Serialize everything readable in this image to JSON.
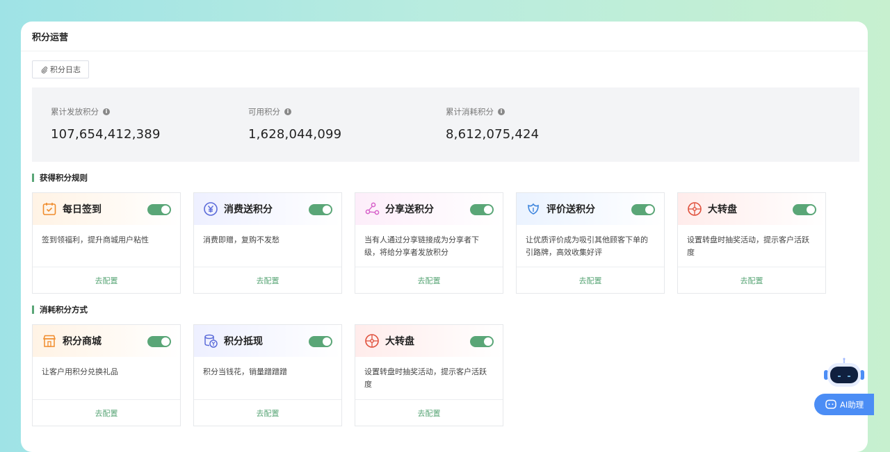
{
  "page": {
    "title": "积分运营"
  },
  "toolbar": {
    "log_label": "积分日志"
  },
  "stats": [
    {
      "label": "累计发放积分",
      "value": "107,654,412,389"
    },
    {
      "label": "可用积分",
      "value": "1,628,044,099"
    },
    {
      "label": "累计消耗积分",
      "value": "8,612,075,424"
    }
  ],
  "earn_section": {
    "title": "获得积分规则",
    "cards": [
      {
        "title": "每日签到",
        "desc": "签到领福利，提升商城用户粘性",
        "action": "去配置",
        "icon": "calendar-check-icon",
        "enabled": true
      },
      {
        "title": "消费送积分",
        "desc": "消费即赠，复购不发愁",
        "action": "去配置",
        "icon": "yen-circle-icon",
        "enabled": true
      },
      {
        "title": "分享送积分",
        "desc": "当有人通过分享链接成为分享者下级，将给分享者发放积分",
        "action": "去配置",
        "icon": "share-icon",
        "enabled": true
      },
      {
        "title": "评价送积分",
        "desc": "让优质评价成为吸引其他顾客下单的引路牌，高效收集好评",
        "action": "去配置",
        "icon": "review-flower-icon",
        "enabled": true
      },
      {
        "title": "大转盘",
        "desc": "设置转盘时抽奖活动，提示客户活跃度",
        "action": "去配置",
        "icon": "wheel-icon",
        "enabled": true
      }
    ]
  },
  "spend_section": {
    "title": "消耗积分方式",
    "cards": [
      {
        "title": "积分商城",
        "desc": "让客户用积分兑换礼品",
        "action": "去配置",
        "icon": "store-icon",
        "enabled": true
      },
      {
        "title": "积分抵现",
        "desc": "积分当钱花，销量蹭蹭蹭",
        "action": "去配置",
        "icon": "coin-stack-icon",
        "enabled": true
      },
      {
        "title": "大转盘",
        "desc": "设置转盘时抽奖活动，提示客户活跃度",
        "action": "去配置",
        "icon": "wheel-icon",
        "enabled": true
      }
    ]
  },
  "assistant": {
    "label": "AI助理"
  },
  "colors": {
    "accent": "#5aa677",
    "ai_button": "#4b8df5",
    "stats_bg": "#f3f4f6"
  }
}
